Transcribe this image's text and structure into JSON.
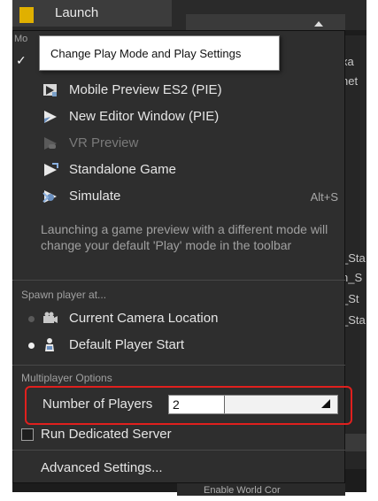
{
  "background": {
    "top_item": "Launch",
    "menu_header_partial": "Mo",
    "right_column": [
      "xa",
      "net",
      "_Sta",
      "n_S",
      "_St",
      "_Sta"
    ],
    "bottom_partial": "Enable World Cor"
  },
  "tooltip": "Change Play Mode and Play Settings",
  "play_modes": [
    {
      "label": "Mobile Preview ES2 (PIE)",
      "icon": "mobile-preview-icon",
      "enabled": true
    },
    {
      "label": "New Editor Window (PIE)",
      "icon": "editor-window-icon",
      "enabled": true
    },
    {
      "label": "VR Preview",
      "icon": "vr-preview-icon",
      "enabled": false
    },
    {
      "label": "Standalone Game",
      "icon": "standalone-game-icon",
      "enabled": true
    },
    {
      "label": "Simulate",
      "icon": "simulate-icon",
      "enabled": true,
      "shortcut": "Alt+S"
    }
  ],
  "description": "Launching a game preview with a different mode will change your default 'Play' mode in the toolbar",
  "spawn": {
    "heading": "Spawn player at...",
    "options": [
      {
        "label": "Current Camera Location",
        "icon": "camera-icon",
        "selected": false
      },
      {
        "label": "Default Player Start",
        "icon": "player-start-icon",
        "selected": true
      }
    ]
  },
  "multiplayer": {
    "heading": "Multiplayer Options",
    "num_players_label": "Number of Players",
    "num_players_value": "2",
    "dedicated_server_label": "Run Dedicated Server",
    "dedicated_server_checked": false
  },
  "advanced_label": "Advanced Settings...",
  "colors": {
    "menu_bg": "#2e2e2e",
    "highlight": "#e0201e",
    "text": "#e6e6e6"
  }
}
